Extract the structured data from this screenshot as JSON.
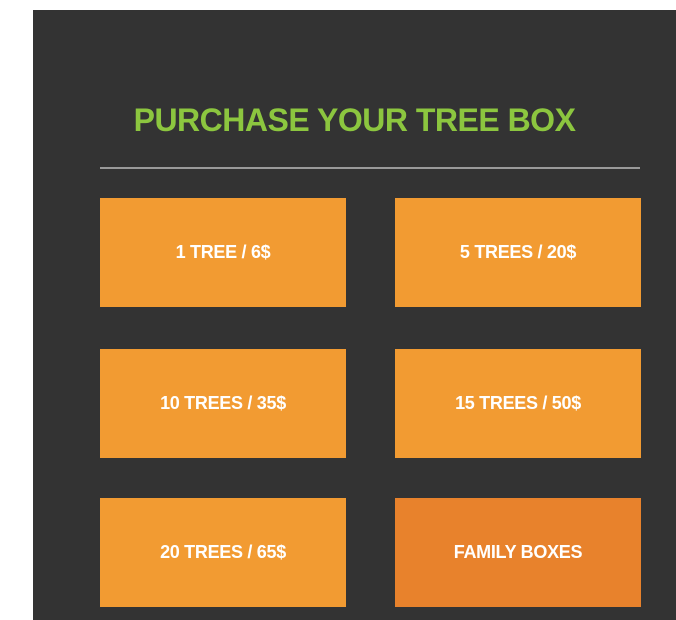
{
  "section": {
    "title": "PURCHASE YOUR TREE BOX",
    "title_color": "#8cc63f",
    "background_color": "#333333"
  },
  "options": [
    {
      "label": "1 TREE / 6$",
      "color": "#f29b32"
    },
    {
      "label": "5 TREES / 20$",
      "color": "#f29b32"
    },
    {
      "label": "10 TREES / 35$",
      "color": "#f29b32"
    },
    {
      "label": "15 TREES / 50$",
      "color": "#f29b32"
    },
    {
      "label": "20 TREES / 65$",
      "color": "#f29b32"
    },
    {
      "label": "FAMILY BOXES",
      "color": "#e8822c"
    }
  ]
}
